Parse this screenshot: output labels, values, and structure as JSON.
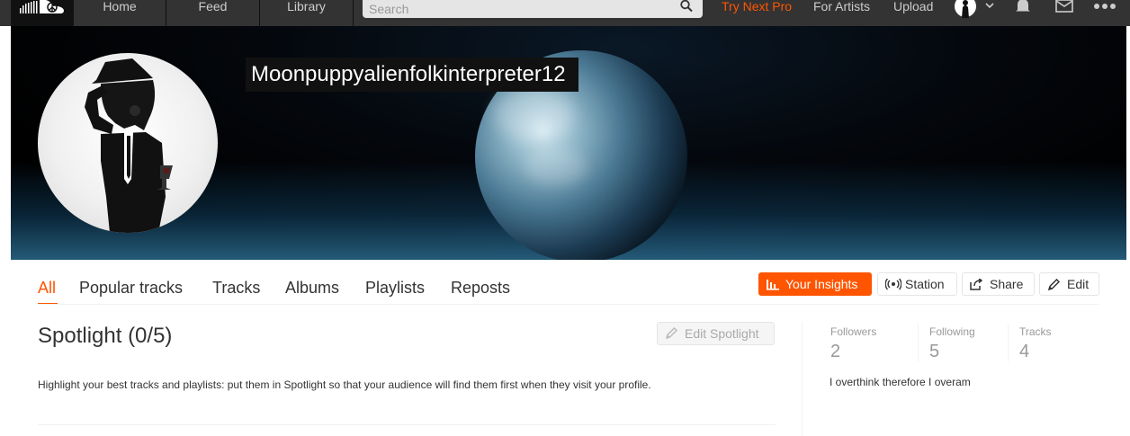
{
  "nav": {
    "home": "Home",
    "feed": "Feed",
    "library": "Library",
    "search_placeholder": "Search",
    "try_pro": "Try Next Pro",
    "for_artists": "For Artists",
    "upload": "Upload"
  },
  "profile": {
    "username": "Moonpuppyalienfolkinterpreter12"
  },
  "tabs": [
    "All",
    "Popular tracks",
    "Tracks",
    "Albums",
    "Playlists",
    "Reposts"
  ],
  "actions": {
    "insights": "Your Insights",
    "station": "Station",
    "share": "Share",
    "edit": "Edit"
  },
  "spotlight": {
    "title": "Spotlight (0/5)",
    "edit_button": "Edit Spotlight",
    "description": "Highlight your best tracks and playlists: put them in Spotlight so that your audience will find them first when they visit your profile."
  },
  "stats": [
    {
      "label": "Followers",
      "value": "2"
    },
    {
      "label": "Following",
      "value": "5"
    },
    {
      "label": "Tracks",
      "value": "4"
    }
  ],
  "bio": "I overthink therefore I overam",
  "colors": {
    "accent": "#ff5500",
    "nav_bg": "#333333",
    "text": "#333333",
    "muted": "#999999"
  }
}
